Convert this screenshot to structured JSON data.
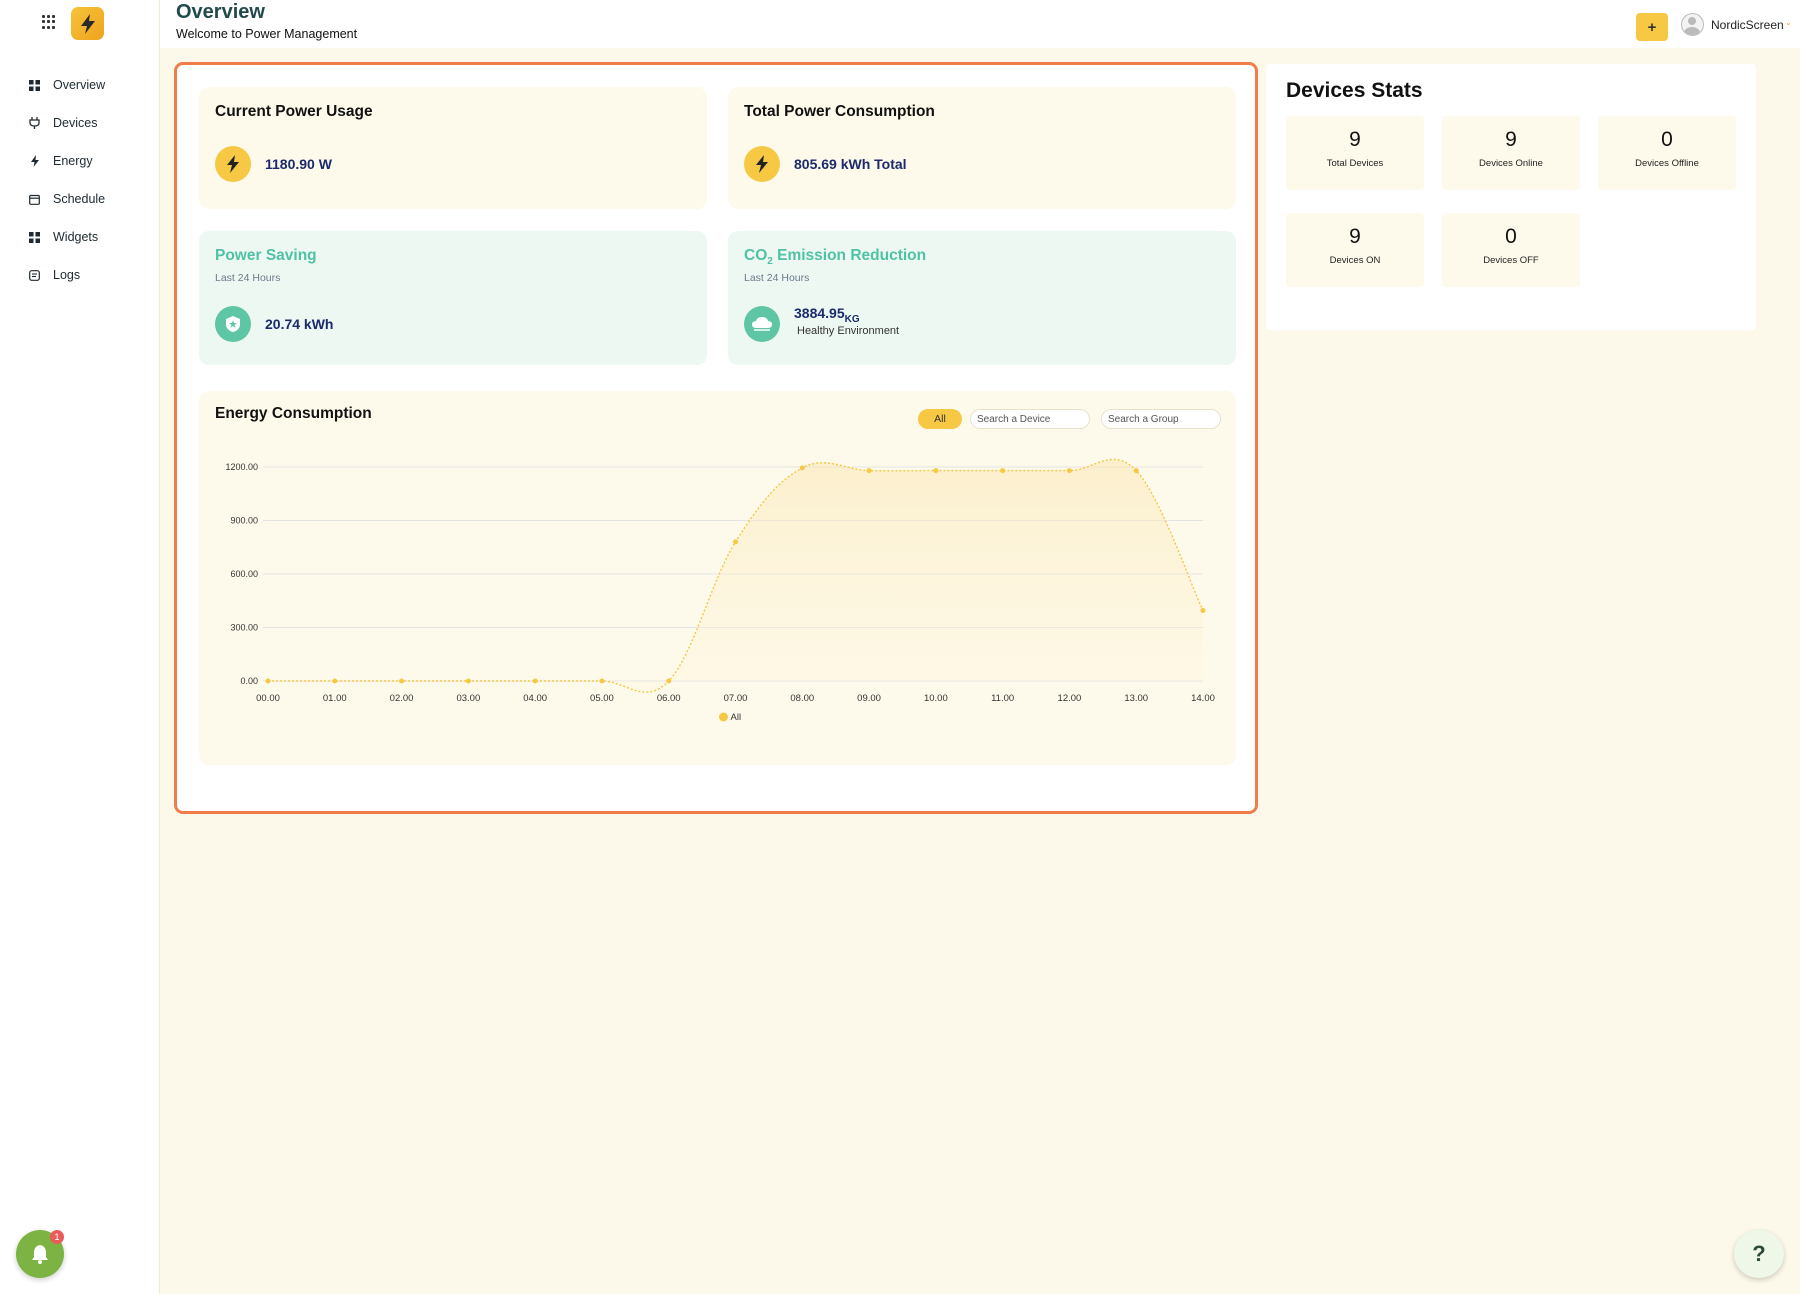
{
  "colors": {
    "accent": "#f6c843",
    "highlight_border": "#f07c4a",
    "teal": "#4fc2a5",
    "value_navy": "#1a2a6c",
    "notification_green": "#7cb342"
  },
  "sidebar": {
    "logo_icon": "lightning-icon",
    "items": [
      {
        "label": "Overview",
        "icon": "grid-icon"
      },
      {
        "label": "Devices",
        "icon": "plug-icon"
      },
      {
        "label": "Energy",
        "icon": "bolt-icon"
      },
      {
        "label": "Schedule",
        "icon": "calendar-icon"
      },
      {
        "label": "Widgets",
        "icon": "widgets-icon"
      },
      {
        "label": "Logs",
        "icon": "log-icon"
      }
    ],
    "notifications_count": "1"
  },
  "header": {
    "title": "Overview",
    "subtitle": "Welcome to Power Management",
    "add_label": "+",
    "username": "NordicScreen",
    "caret": "⌄"
  },
  "cards": {
    "current_power": {
      "title": "Current Power Usage",
      "value": "1180.90 W"
    },
    "total_power": {
      "title": "Total Power Consumption",
      "value": "805.69 kWh Total"
    },
    "power_saving": {
      "title": "Power Saving",
      "subtitle": "Last 24 Hours",
      "value": "20.74 kWh"
    },
    "co2": {
      "title_prefix": "CO",
      "title_sub": "2",
      "title_suffix": " Emission Reduction",
      "subtitle": "Last 24 Hours",
      "value": "3884.95",
      "unit": "KG",
      "note": "Healthy Environment"
    }
  },
  "energy": {
    "title": "Energy Consumption",
    "filter_all": "All",
    "device_search_placeholder": "Search a Device",
    "group_search_placeholder": "Search a Group"
  },
  "chart_data": {
    "type": "area",
    "categories": [
      "00.00",
      "01.00",
      "02.00",
      "03.00",
      "04.00",
      "05.00",
      "06.00",
      "07.00",
      "08.00",
      "09.00",
      "10.00",
      "11.00",
      "12.00",
      "13.00",
      "14.00"
    ],
    "series": [
      {
        "name": "All",
        "values": [
          0,
          0,
          0,
          0,
          0,
          0,
          0,
          780,
          1195,
          1180,
          1180,
          1180,
          1180,
          1180,
          395
        ]
      }
    ],
    "y_ticks": [
      "0.00",
      "300.00",
      "600.00",
      "900.00",
      "1200.00"
    ],
    "ylim": [
      0,
      1200
    ],
    "grid": true,
    "legend": "bottom-center",
    "color": "#f6c843"
  },
  "devices_stats": {
    "title": "Devices Stats",
    "items": [
      {
        "value": "9",
        "label": "Total Devices"
      },
      {
        "value": "9",
        "label": "Devices Online"
      },
      {
        "value": "0",
        "label": "Devices Offline"
      },
      {
        "value": "9",
        "label": "Devices ON"
      },
      {
        "value": "0",
        "label": "Devices OFF"
      }
    ]
  },
  "help_label": "?"
}
